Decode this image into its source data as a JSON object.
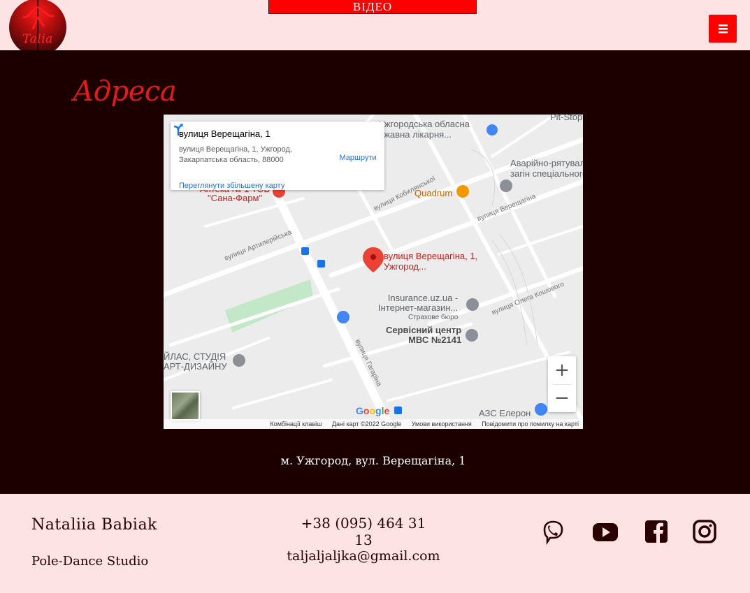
{
  "header": {
    "logo_text": "Talia",
    "video_button_label": "ВІДЕО",
    "menu_icon": "hamburger-icon"
  },
  "section": {
    "title": "Адреса",
    "address_line": "м. Ужгород, вул. Верещагіна, 1"
  },
  "map": {
    "info_card": {
      "title": "вулиця Верещагіна, 1",
      "address_line1": "вулиця Верещагіна, 1, Ужгород,",
      "address_line2": "Закарпатська область, 88000",
      "enlarged_map_link": "Переглянути збільшену карту",
      "directions_label": "Маршрути"
    },
    "pin_label_line1": "вулиця Верещагіна, 1,",
    "pin_label_line2": "Ужгород...",
    "labels": {
      "hospital_line1": "Ужгородська обласна",
      "hospital_line2": "ржавна лікарня...",
      "pitstop": "Pit-Stop",
      "rescue_line1": "Аварійно-рятувальн",
      "rescue_line2": "загін спеціального...",
      "quadrum": "Quadrum",
      "apteka_line1": "Аптека № 1 ТОВ",
      "apteka_line2": "\"Сана-Фарм\"",
      "insurance_line1": "Insurance.uz.ua -",
      "insurance_line2": "Інтернет-магазин...",
      "insurance_line3": "Страхове бюро",
      "mvs_line1": "Сервісний центр",
      "mvs_line2": "МВС №2141",
      "studio_line1": "ЙЛАС, СТУДІЯ",
      "studio_line2": "АРТ-ДИЗАЙНУ",
      "azs": "АЗС Елерон",
      "road_kobylianskoi": "вулиця Кобилянської",
      "road_vereshchahina": "вулиця Верещагіна",
      "road_artylerijska": "вулиця Артилерійська",
      "road_olha_koshovoho": "вулиця Олега Кошового",
      "road_haharina": "вулиця Гагаріна"
    },
    "zoom_in": "+",
    "zoom_out": "−",
    "google_logo": "Google",
    "attribution": {
      "shortcuts": "Комбінації клавіш",
      "map_data": "Дані карт ©2022 Google",
      "terms": "Умови використання",
      "report": "Повідомити про помилку на карті"
    }
  },
  "footer": {
    "name": "Nataliia Babiak",
    "studio": "Pole-Dance Studio",
    "phone": "+38 (095) 464 31 13",
    "email": "taljaljaljka@gmail.com",
    "social_icons": [
      "viber-icon",
      "youtube-icon",
      "facebook-icon",
      "instagram-icon"
    ]
  },
  "colors": {
    "accent_red": "#ff0000",
    "title_red": "#e51b1b",
    "dark_bg": "#1c0000",
    "light_bg": "#fde3e3"
  }
}
